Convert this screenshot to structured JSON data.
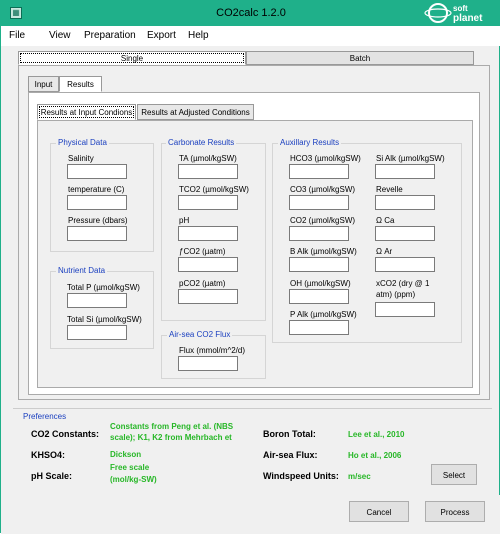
{
  "window": {
    "title": "CO2calc 1.2.0",
    "accent_color": "#1fb08a"
  },
  "logo": {
    "text": "soft planet .com",
    "icon": "planet-logo-icon"
  },
  "menu": [
    "File",
    "View",
    "Preparation",
    "Export",
    "Help"
  ],
  "mode_tabs": {
    "single": "Single",
    "batch": "Batch"
  },
  "tabs": {
    "input": "Input",
    "results": "Results"
  },
  "results_tabs": {
    "input_conditions": "Results at Input Condions",
    "adjusted_conditions": "Results at Adjusted Conditions"
  },
  "physical_data": {
    "title": "Physical Data",
    "salinity": "Salinity",
    "temperature": "temperature (C)",
    "pressure": "Pressure (dbars)"
  },
  "nutrient_data": {
    "title": "Nutrient Data",
    "total_p": "Total P (µmol/kgSW)",
    "total_si": "Total Si (µmol/kgSW)"
  },
  "carbonate": {
    "title": "Carbonate Results",
    "ta": "TA (µmol/kgSW)",
    "tco2": "TCO2 (µmol/kgSW)",
    "ph": "pH",
    "fco2": "ƒCO2 (µatm)",
    "pco2": "pCO2 (µatm)"
  },
  "flux": {
    "title": "Air-sea CO2 Flux",
    "label": "Flux (mmol/m^2/d)"
  },
  "auxillary": {
    "title": "Auxillary Results",
    "hco3": "HCO3 (µmol/kgSW)",
    "co3": "CO3 (µmol/kgSW)",
    "co2": "CO2 (µmol/kgSW)",
    "b_alk": "B Alk (µmol/kgSW)",
    "oh": "OH (µmol/kgSW)",
    "p_alk": "P Alk (µmol/kgSW)",
    "si_alk": "Si Alk (µmol/kgSW)",
    "revelle": "Revelle",
    "omega_ca": "Ω Ca",
    "omega_ar": "Ω Ar",
    "xco2_1": "xCO2 (dry @ 1",
    "xco2_2": "atm) (ppm)"
  },
  "preferences": {
    "title": "Preferences",
    "co2_constants_label": "CO2 Constants:",
    "co2_constants_value_1": "Constants from Peng et al. (NBS",
    "co2_constants_value_2": "scale); K1, K2 from Mehrbach et",
    "khso4_label": "KHSO4:",
    "khso4_value": "Dickson",
    "ph_scale_label": "pH Scale:",
    "ph_scale_value_1": "Free scale",
    "ph_scale_value_2": "(mol/kg-SW)",
    "boron_label": "Boron Total:",
    "boron_value": "Lee et al., 2010",
    "flux_label": "Air-sea Flux:",
    "flux_value": "Ho et al., 2006",
    "windspeed_label": "Windspeed Units:",
    "windspeed_value": "m/sec",
    "value_color": "#27b727"
  },
  "buttons": {
    "select": "Select",
    "cancel": "Cancel",
    "process": "Process"
  }
}
